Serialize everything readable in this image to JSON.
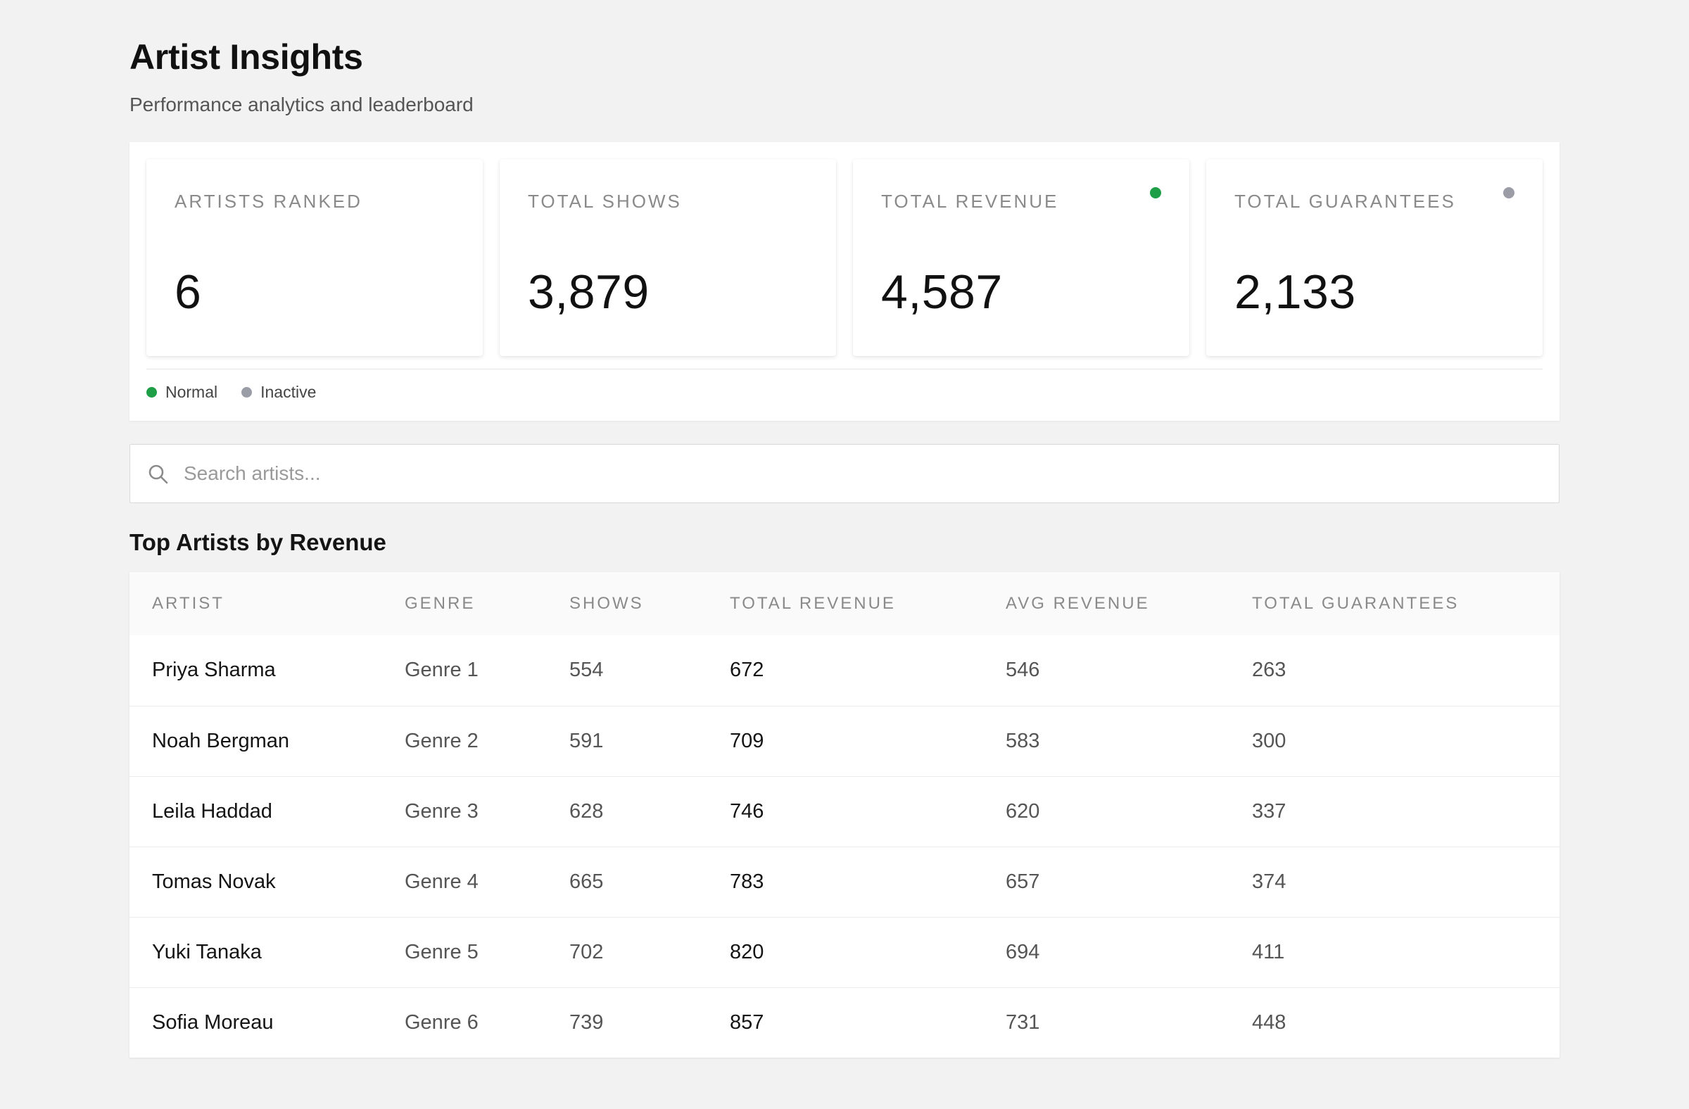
{
  "header": {
    "title": "Artist Insights",
    "subtitle": "Performance analytics and leaderboard"
  },
  "stats": [
    {
      "label": "ARTISTS RANKED",
      "value": "6",
      "status": null
    },
    {
      "label": "TOTAL SHOWS",
      "value": "3,879",
      "status": null
    },
    {
      "label": "TOTAL REVENUE",
      "value": "4,587",
      "status": "normal"
    },
    {
      "label": "TOTAL GUARANTEES",
      "value": "2,133",
      "status": "inactive"
    }
  ],
  "legend": [
    {
      "label": "Normal",
      "color": "#1e9e46"
    },
    {
      "label": "Inactive",
      "color": "#9a9da6"
    }
  ],
  "colors": {
    "normal": "#1e9e46",
    "inactive": "#9a9da6"
  },
  "search": {
    "placeholder": "Search artists...",
    "value": ""
  },
  "table": {
    "title": "Top Artists by Revenue",
    "columns": [
      "ARTIST",
      "GENRE",
      "SHOWS",
      "TOTAL REVENUE",
      "AVG REVENUE",
      "TOTAL GUARANTEES"
    ],
    "rows": [
      [
        "Priya Sharma",
        "Genre 1",
        "554",
        "672",
        "546",
        "263"
      ],
      [
        "Noah Bergman",
        "Genre 2",
        "591",
        "709",
        "583",
        "300"
      ],
      [
        "Leila Haddad",
        "Genre 3",
        "628",
        "746",
        "620",
        "337"
      ],
      [
        "Tomas Novak",
        "Genre 4",
        "665",
        "783",
        "657",
        "374"
      ],
      [
        "Yuki Tanaka",
        "Genre 5",
        "702",
        "820",
        "694",
        "411"
      ],
      [
        "Sofia Moreau",
        "Genre 6",
        "739",
        "857",
        "731",
        "448"
      ]
    ]
  }
}
